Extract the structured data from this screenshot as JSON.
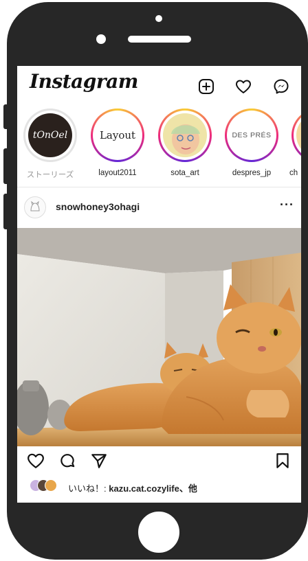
{
  "app": {
    "name": "Instagram"
  },
  "header": {
    "new_post_icon": "plus-square-icon",
    "activity_icon": "heart-icon",
    "messages_icon": "messenger-icon"
  },
  "stories": [
    {
      "label": "ストーリーズ",
      "avatar_text": "tOnOel",
      "kind": "own"
    },
    {
      "label": "layout2011",
      "avatar_text": "Layout"
    },
    {
      "label": "sota_art",
      "avatar_text": ""
    },
    {
      "label": "despres_jp",
      "avatar_text": "DES PRÉS"
    },
    {
      "label": "ch",
      "avatar_text": ""
    }
  ],
  "post": {
    "username": "snowhoney3ohagi",
    "more_label": "···",
    "likes_prefix": "いいね！: ",
    "likes_user": "kazu.cat.cozylife",
    "likes_suffix": "、他"
  },
  "colors": {
    "frame": "#272727",
    "story_ring_start": "#f9ce34",
    "story_ring_mid": "#ee2a7b",
    "story_ring_end": "#6228d7"
  }
}
